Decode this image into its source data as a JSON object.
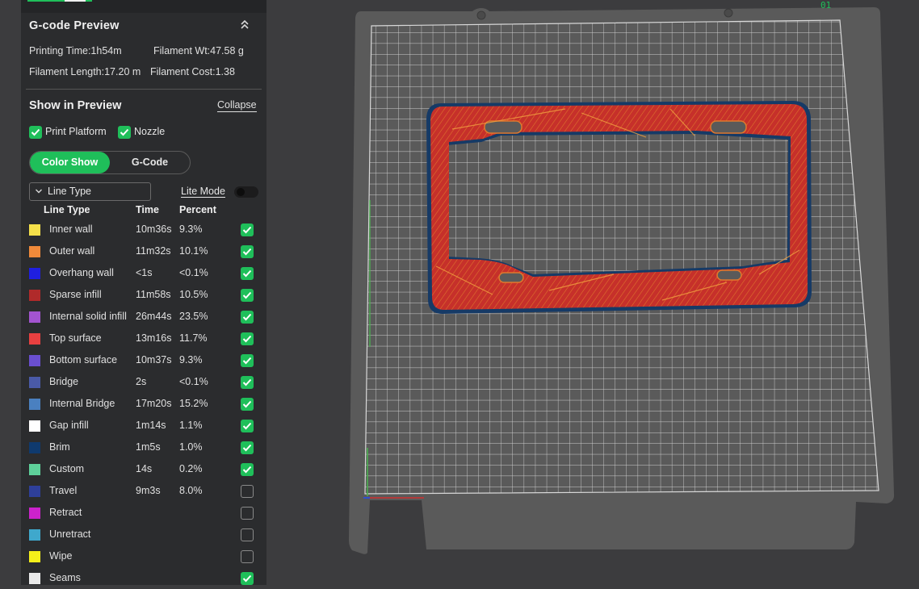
{
  "gcode_preview": {
    "title": "G-code Preview",
    "printing_time": "Printing Time:1h54m",
    "filament_wt": "Filament Wt:47.58 g",
    "filament_length": "Filament Length:17.20 m",
    "filament_cost": "Filament Cost:1.38"
  },
  "show_in_preview": {
    "title": "Show in Preview",
    "collapse_label": "Collapse",
    "print_platform": {
      "label": "Print Platform",
      "checked": true
    },
    "nozzle": {
      "label": "Nozzle",
      "checked": true
    }
  },
  "view_tabs": {
    "color_show": "Color Show",
    "gcode": "G-Code",
    "active": "Color Show"
  },
  "filter": {
    "dropdown_value": "Line Type",
    "lite_mode_label": "Lite Mode",
    "lite_mode_on": false
  },
  "table": {
    "headers": {
      "type": "Line Type",
      "time": "Time",
      "percent": "Percent"
    },
    "rows": [
      {
        "type": "Inner wall",
        "time": "10m36s",
        "percent": "9.3%",
        "color": "#f5e04a",
        "checked": true
      },
      {
        "type": "Outer wall",
        "time": "11m32s",
        "percent": "10.1%",
        "color": "#f08a3a",
        "checked": true
      },
      {
        "type": "Overhang wall",
        "time": "<1s",
        "percent": "<0.1%",
        "color": "#1f1fe0",
        "checked": true
      },
      {
        "type": "Sparse infill",
        "time": "11m58s",
        "percent": "10.5%",
        "color": "#b02a2a",
        "checked": true
      },
      {
        "type": "Internal solid infill",
        "time": "26m44s",
        "percent": "23.5%",
        "color": "#a354d0",
        "checked": true
      },
      {
        "type": "Top surface",
        "time": "13m16s",
        "percent": "11.7%",
        "color": "#e84040",
        "checked": true
      },
      {
        "type": "Bottom surface",
        "time": "10m37s",
        "percent": "9.3%",
        "color": "#6a4fd0",
        "checked": true
      },
      {
        "type": "Bridge",
        "time": "2s",
        "percent": "<0.1%",
        "color": "#4a5aa8",
        "checked": true
      },
      {
        "type": "Internal Bridge",
        "time": "17m20s",
        "percent": "15.2%",
        "color": "#4a80c0",
        "checked": true
      },
      {
        "type": "Gap infill",
        "time": "1m14s",
        "percent": "1.1%",
        "color": "#ffffff",
        "checked": true
      },
      {
        "type": "Brim",
        "time": "1m5s",
        "percent": "1.0%",
        "color": "#0f3a6e",
        "checked": true
      },
      {
        "type": "Custom",
        "time": "14s",
        "percent": "0.2%",
        "color": "#5ed09a",
        "checked": true
      },
      {
        "type": "Travel",
        "time": "9m3s",
        "percent": "8.0%",
        "color": "#2e3f9a",
        "checked": false
      },
      {
        "type": "Retract",
        "time": "",
        "percent": "",
        "color": "#cc22cc",
        "checked": false
      },
      {
        "type": "Unretract",
        "time": "",
        "percent": "",
        "color": "#3fa8cc",
        "checked": false
      },
      {
        "type": "Wipe",
        "time": "",
        "percent": "",
        "color": "#f5f01a",
        "checked": false
      },
      {
        "type": "Seams",
        "time": "",
        "percent": "",
        "color": "#eaeaea",
        "checked": true
      }
    ]
  },
  "viewport": {
    "plate_color": "#595959",
    "grid_color": "#d8d8d8",
    "model_color": "#c6302a",
    "model_outline": "#163a66",
    "plate_number": "01"
  }
}
